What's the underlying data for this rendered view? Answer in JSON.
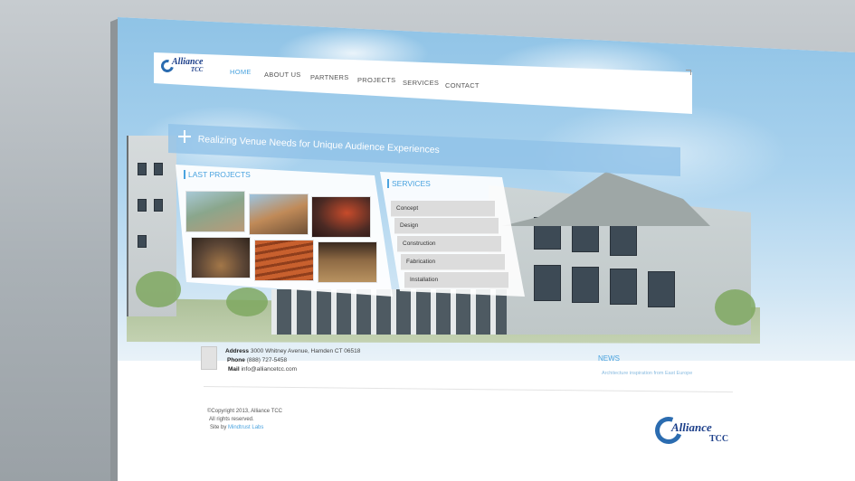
{
  "brand": {
    "logo_text": "Alliance",
    "logo_sub": "TCC"
  },
  "nav": {
    "items": [
      {
        "label": "HOME",
        "active": true
      },
      {
        "label": "ABOUT US",
        "active": false
      },
      {
        "label": "PARTNERS",
        "active": false
      },
      {
        "label": "PROJECTS",
        "active": false
      },
      {
        "label": "SERVICES",
        "active": false
      },
      {
        "label": "CONTACT",
        "active": false
      }
    ]
  },
  "banner": {
    "text": "Realizing Venue Needs for Unique Audience Experiences"
  },
  "last_projects": {
    "title": "LAST PROJECTS",
    "thumbnails": [
      {
        "icon": "campus-building-photo",
        "color": "#7b9b86"
      },
      {
        "icon": "building-facade-photo",
        "color": "#a17850"
      },
      {
        "icon": "theater-interior-photo",
        "color": "#4b2a24"
      },
      {
        "icon": "auditorium-photo",
        "color": "#5c4636"
      },
      {
        "icon": "red-seating-photo",
        "color": "#b0552c"
      },
      {
        "icon": "concert-hall-photo",
        "color": "#6e4b32"
      }
    ]
  },
  "services": {
    "title": "SERVICES",
    "items": [
      "Concept",
      "Design",
      "Construction",
      "Fabrication",
      "Installation"
    ]
  },
  "footer": {
    "address_label": "Address",
    "address_value": "3000 Whitney Avenue, Hamden CT 06518",
    "phone_label": "Phone",
    "phone_value": "(888) 727-5458",
    "mail_label": "Mail",
    "mail_value": "info@alliancetcc.com",
    "news_title": "NEWS",
    "news_link": "Architecture inspiration from East Europe",
    "copyright": "©Copyright 2013, Alliance TCC",
    "rights": "All rights reserved.",
    "site_by_label": "Site by",
    "site_by_link": "Mindtrust Labs"
  },
  "colors": {
    "accent": "#4aa3df",
    "brand": "#1c3f8a",
    "banner": "#90c2e8"
  }
}
